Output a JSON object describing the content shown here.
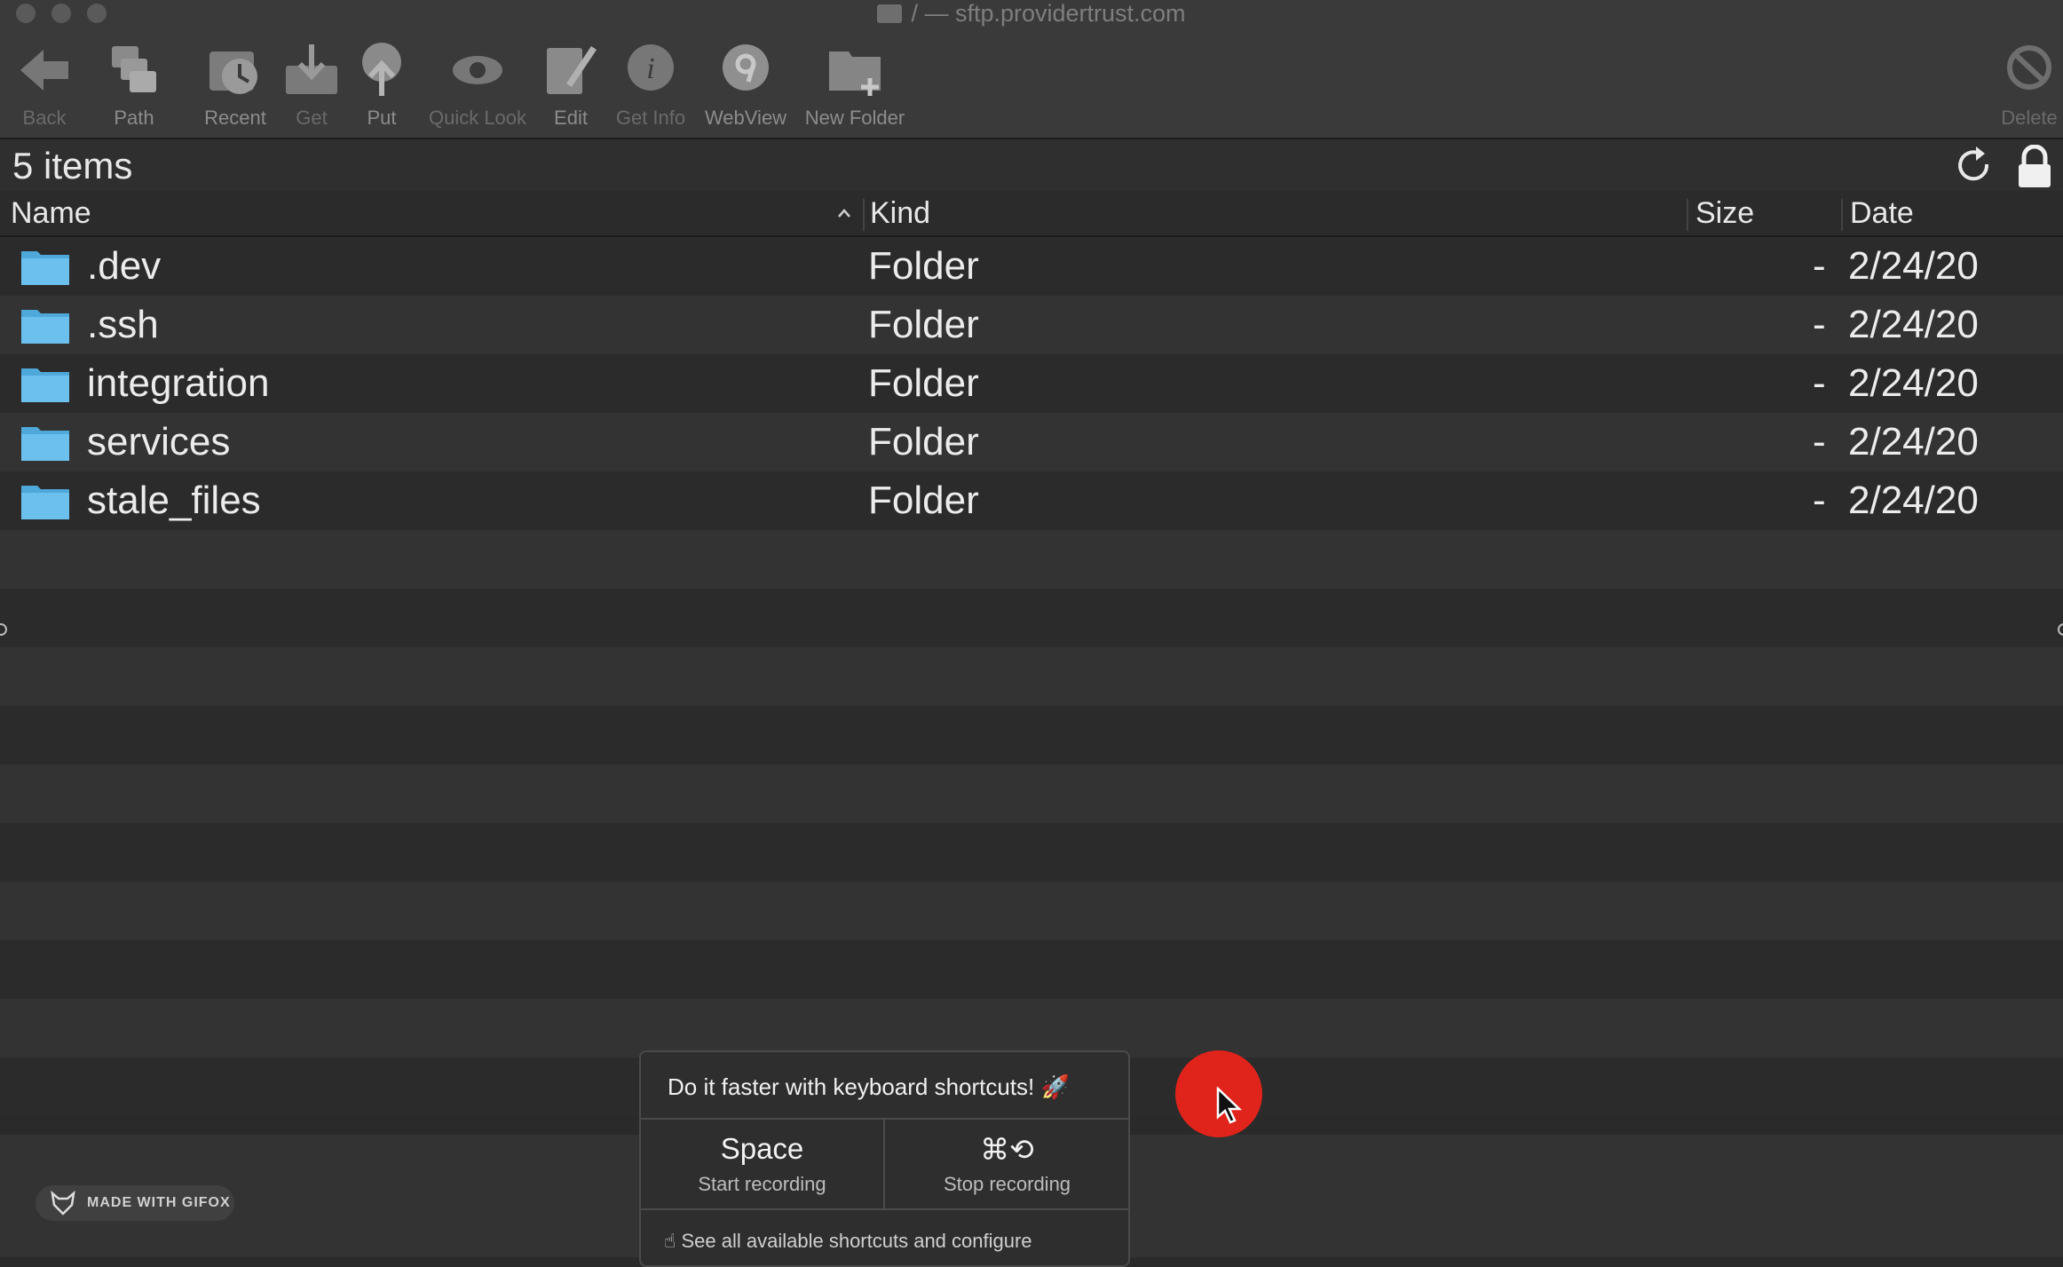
{
  "window": {
    "title": "/ — sftp.providertrust.com"
  },
  "toolbar": {
    "back": "Back",
    "path": "Path",
    "recent": "Recent",
    "get": "Get",
    "put": "Put",
    "quick_look": "Quick Look",
    "edit": "Edit",
    "get_info": "Get Info",
    "webview": "WebView",
    "new_folder": "New Folder",
    "delete": "Delete"
  },
  "status": {
    "item_count": "5 items"
  },
  "columns": {
    "name": "Name",
    "kind": "Kind",
    "size": "Size",
    "date": "Date"
  },
  "files": [
    {
      "name": ".dev",
      "kind": "Folder",
      "size": "-",
      "date": "2/24/20"
    },
    {
      "name": ".ssh",
      "kind": "Folder",
      "size": "-",
      "date": "2/24/20"
    },
    {
      "name": "integration",
      "kind": "Folder",
      "size": "-",
      "date": "2/24/20"
    },
    {
      "name": "services",
      "kind": "Folder",
      "size": "-",
      "date": "2/24/20"
    },
    {
      "name": "stale_files",
      "kind": "Folder",
      "size": "-",
      "date": "2/24/20"
    }
  ],
  "popover": {
    "heading": "Do it faster with keyboard shortcuts! 🚀",
    "shortcut1_key": "Space",
    "shortcut1_label": "Start recording",
    "shortcut2_key": "⌘⟲",
    "shortcut2_label": "Stop recording",
    "footer": "☝ See all available shortcuts and configure"
  },
  "badge": {
    "label": "MADE WITH GIFOX"
  },
  "colors": {
    "folder": "#5fb6e6",
    "record": "#e0231b",
    "background": "#2a2a2a"
  }
}
